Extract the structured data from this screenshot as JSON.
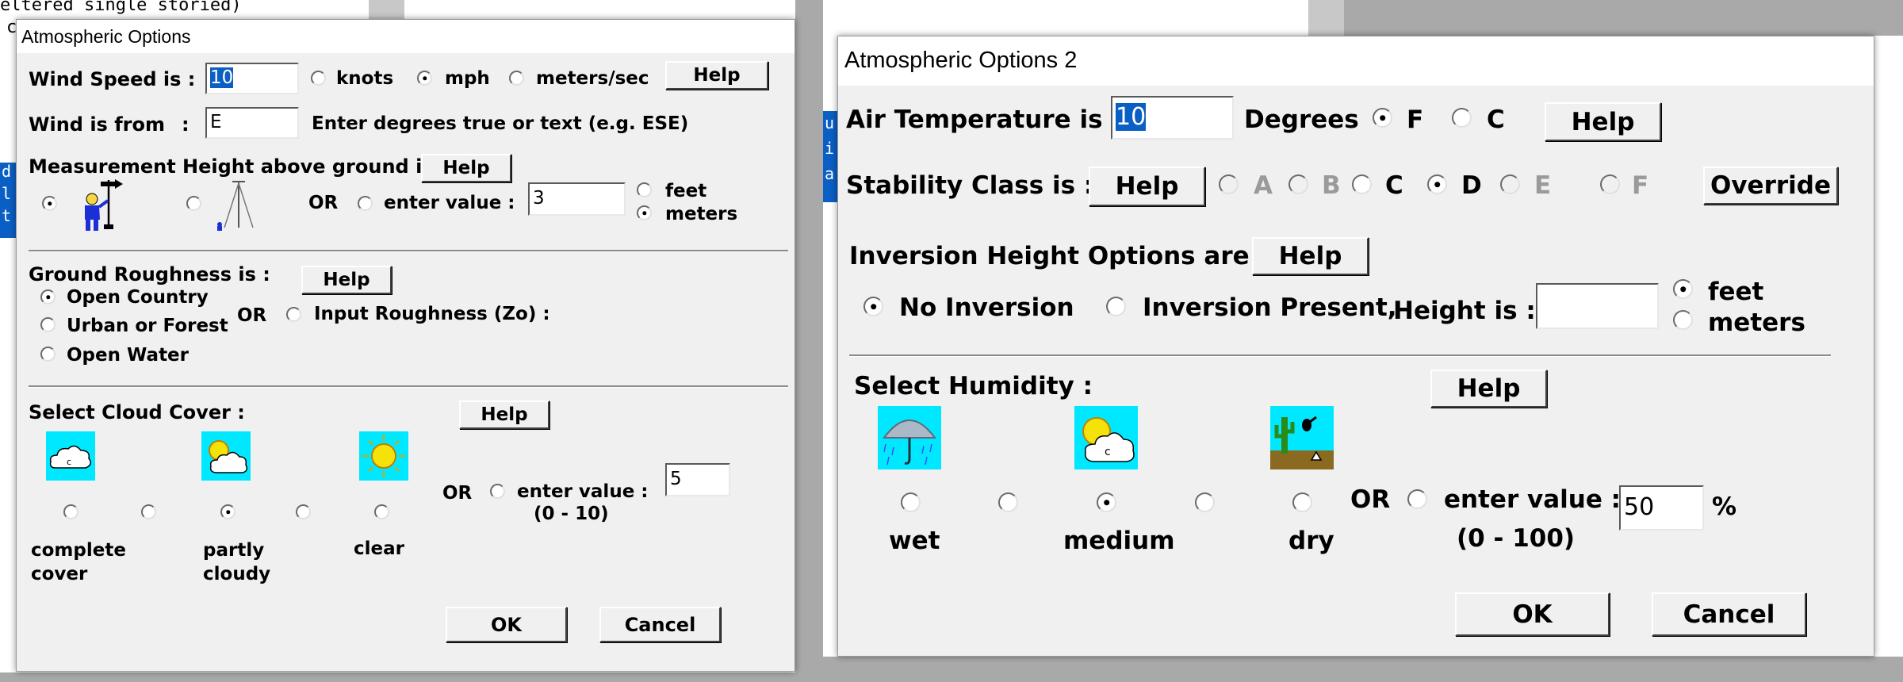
{
  "background": {
    "code_line_1": "eltered single storied)",
    "code_line_2": "c",
    "selection_left": [
      "d",
      "l",
      "t"
    ],
    "selection_right": [
      "u",
      "i",
      "a"
    ]
  },
  "dialog1": {
    "title": "Atmospheric Options",
    "wind_speed": {
      "label": "Wind Speed is :",
      "value": "10",
      "units": [
        {
          "label": "knots",
          "selected": false
        },
        {
          "label": "mph",
          "selected": true
        },
        {
          "label": "meters/sec",
          "selected": false
        }
      ],
      "help": "Help"
    },
    "wind_from": {
      "label": "Wind is from",
      "colon": ":",
      "value": "E",
      "hint": "Enter degrees true or text (e.g. ESE)"
    },
    "measurement_height": {
      "label": "Measurement Height above ground is:",
      "help": "Help",
      "or": "OR",
      "enter_value_label": "enter value :",
      "value": "3",
      "units": [
        {
          "label": "feet",
          "selected": false
        },
        {
          "label": "meters",
          "selected": true
        }
      ]
    },
    "ground_roughness": {
      "label": "Ground Roughness is :",
      "help": "Help",
      "options": [
        {
          "label": "Open Country",
          "selected": true
        },
        {
          "label": "Urban or Forest",
          "selected": false
        },
        {
          "label": "Open Water",
          "selected": false
        }
      ],
      "or": "OR",
      "input_label": "Input Roughness (Zo) :"
    },
    "cloud_cover": {
      "label": "Select Cloud Cover :",
      "help": "Help",
      "captions": [
        "complete cover",
        "partly cloudy",
        "clear"
      ],
      "selected_index": 2,
      "or": "OR",
      "enter_value_label": "enter value :",
      "range": "(0 - 10)",
      "value": "5"
    },
    "ok": "OK",
    "cancel": "Cancel"
  },
  "dialog2": {
    "title": "Atmospheric Options 2",
    "air_temperature": {
      "label": "Air Temperature is :",
      "value": "10",
      "units_label": "Degrees",
      "units": [
        {
          "label": "F",
          "selected": true
        },
        {
          "label": "C",
          "selected": false
        }
      ],
      "help": "Help"
    },
    "stability_class": {
      "label": "Stability Class is :",
      "help": "Help",
      "classes": [
        {
          "label": "A",
          "enabled": false,
          "selected": false
        },
        {
          "label": "B",
          "enabled": false,
          "selected": false
        },
        {
          "label": "C",
          "enabled": true,
          "selected": false
        },
        {
          "label": "D",
          "enabled": true,
          "selected": true
        },
        {
          "label": "E",
          "enabled": false,
          "selected": false
        },
        {
          "label": "F",
          "enabled": false,
          "selected": false
        }
      ],
      "override": "Override"
    },
    "inversion": {
      "label": "Inversion Height Options are :",
      "help": "Help",
      "no_inversion": "No Inversion",
      "inversion_present": "Inversion Present,",
      "height_label": "Height is :",
      "value": "",
      "units": [
        {
          "label": "feet",
          "selected": true
        },
        {
          "label": "meters",
          "selected": false
        }
      ]
    },
    "humidity": {
      "label": "Select Humidity :",
      "help": "Help",
      "captions": [
        "wet",
        "medium",
        "dry"
      ],
      "selected_index": 2,
      "or": "OR",
      "enter_value_label": "enter value :",
      "range": "(0 - 100)",
      "value": "50",
      "percent": "%"
    },
    "ok": "OK",
    "cancel": "Cancel"
  }
}
